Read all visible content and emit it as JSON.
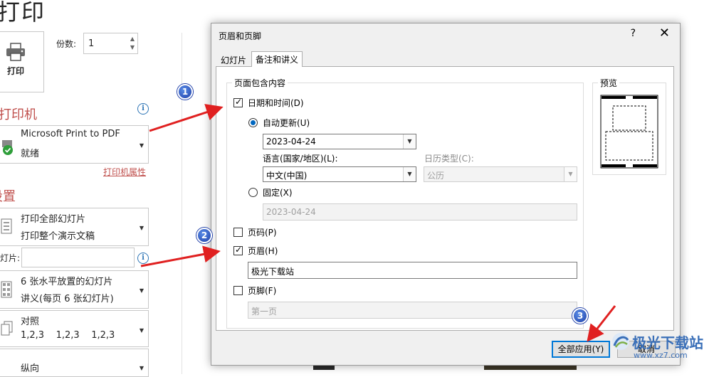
{
  "backstage": {
    "title": "打印",
    "print_button": "打印",
    "copies_label": "份数:",
    "copies_value": "1",
    "printer_heading": "打印机",
    "printer_name": "Microsoft Print to PDF",
    "printer_status": "就绪",
    "printer_properties": "打印机属性",
    "settings_heading": "设置",
    "slides_option_line1": "打印全部幻灯片",
    "slides_option_line2": "打印整个演示文稿",
    "slides_label": "幻灯片:",
    "layout_line1": "6 张水平放置的幻灯片",
    "layout_line2": "讲义(每页 6 张幻灯片)",
    "collate_line1": "对照",
    "collate_line2": "1,2,3    1,2,3    1,2,3",
    "orientation": "纵向"
  },
  "dialog": {
    "title": "页眉和页脚",
    "help": "?",
    "close": "✕",
    "tabs": [
      {
        "label": "幻灯片",
        "active": false
      },
      {
        "label": "备注和讲义",
        "active": true
      }
    ],
    "group_label": "页面包含内容",
    "date_time": {
      "label": "日期和时间(D)",
      "checked": true
    },
    "auto_update": {
      "label": "自动更新(U)",
      "selected": true
    },
    "auto_date_value": "2023-04-24",
    "language_label": "语言(国家/地区)(L):",
    "language_value": "中文(中国)",
    "calendar_label": "日历类型(C):",
    "calendar_value": "公历",
    "fixed": {
      "label": "固定(X)",
      "selected": false
    },
    "fixed_value": "2023-04-24",
    "page_number": {
      "label": "页码(P)",
      "checked": false
    },
    "header": {
      "label": "页眉(H)",
      "checked": true
    },
    "header_value": "极光下载站",
    "footer": {
      "label": "页脚(F)",
      "checked": false
    },
    "footer_value": "第一页",
    "preview_label": "预览",
    "apply_all": "全部应用(Y)",
    "cancel": "取消"
  },
  "annotations": {
    "badge1": "1",
    "badge2": "2",
    "badge3": "3",
    "arrow_color": "#e02020"
  },
  "watermark": {
    "text": "极光下载站",
    "url": "www.xz7.com"
  }
}
